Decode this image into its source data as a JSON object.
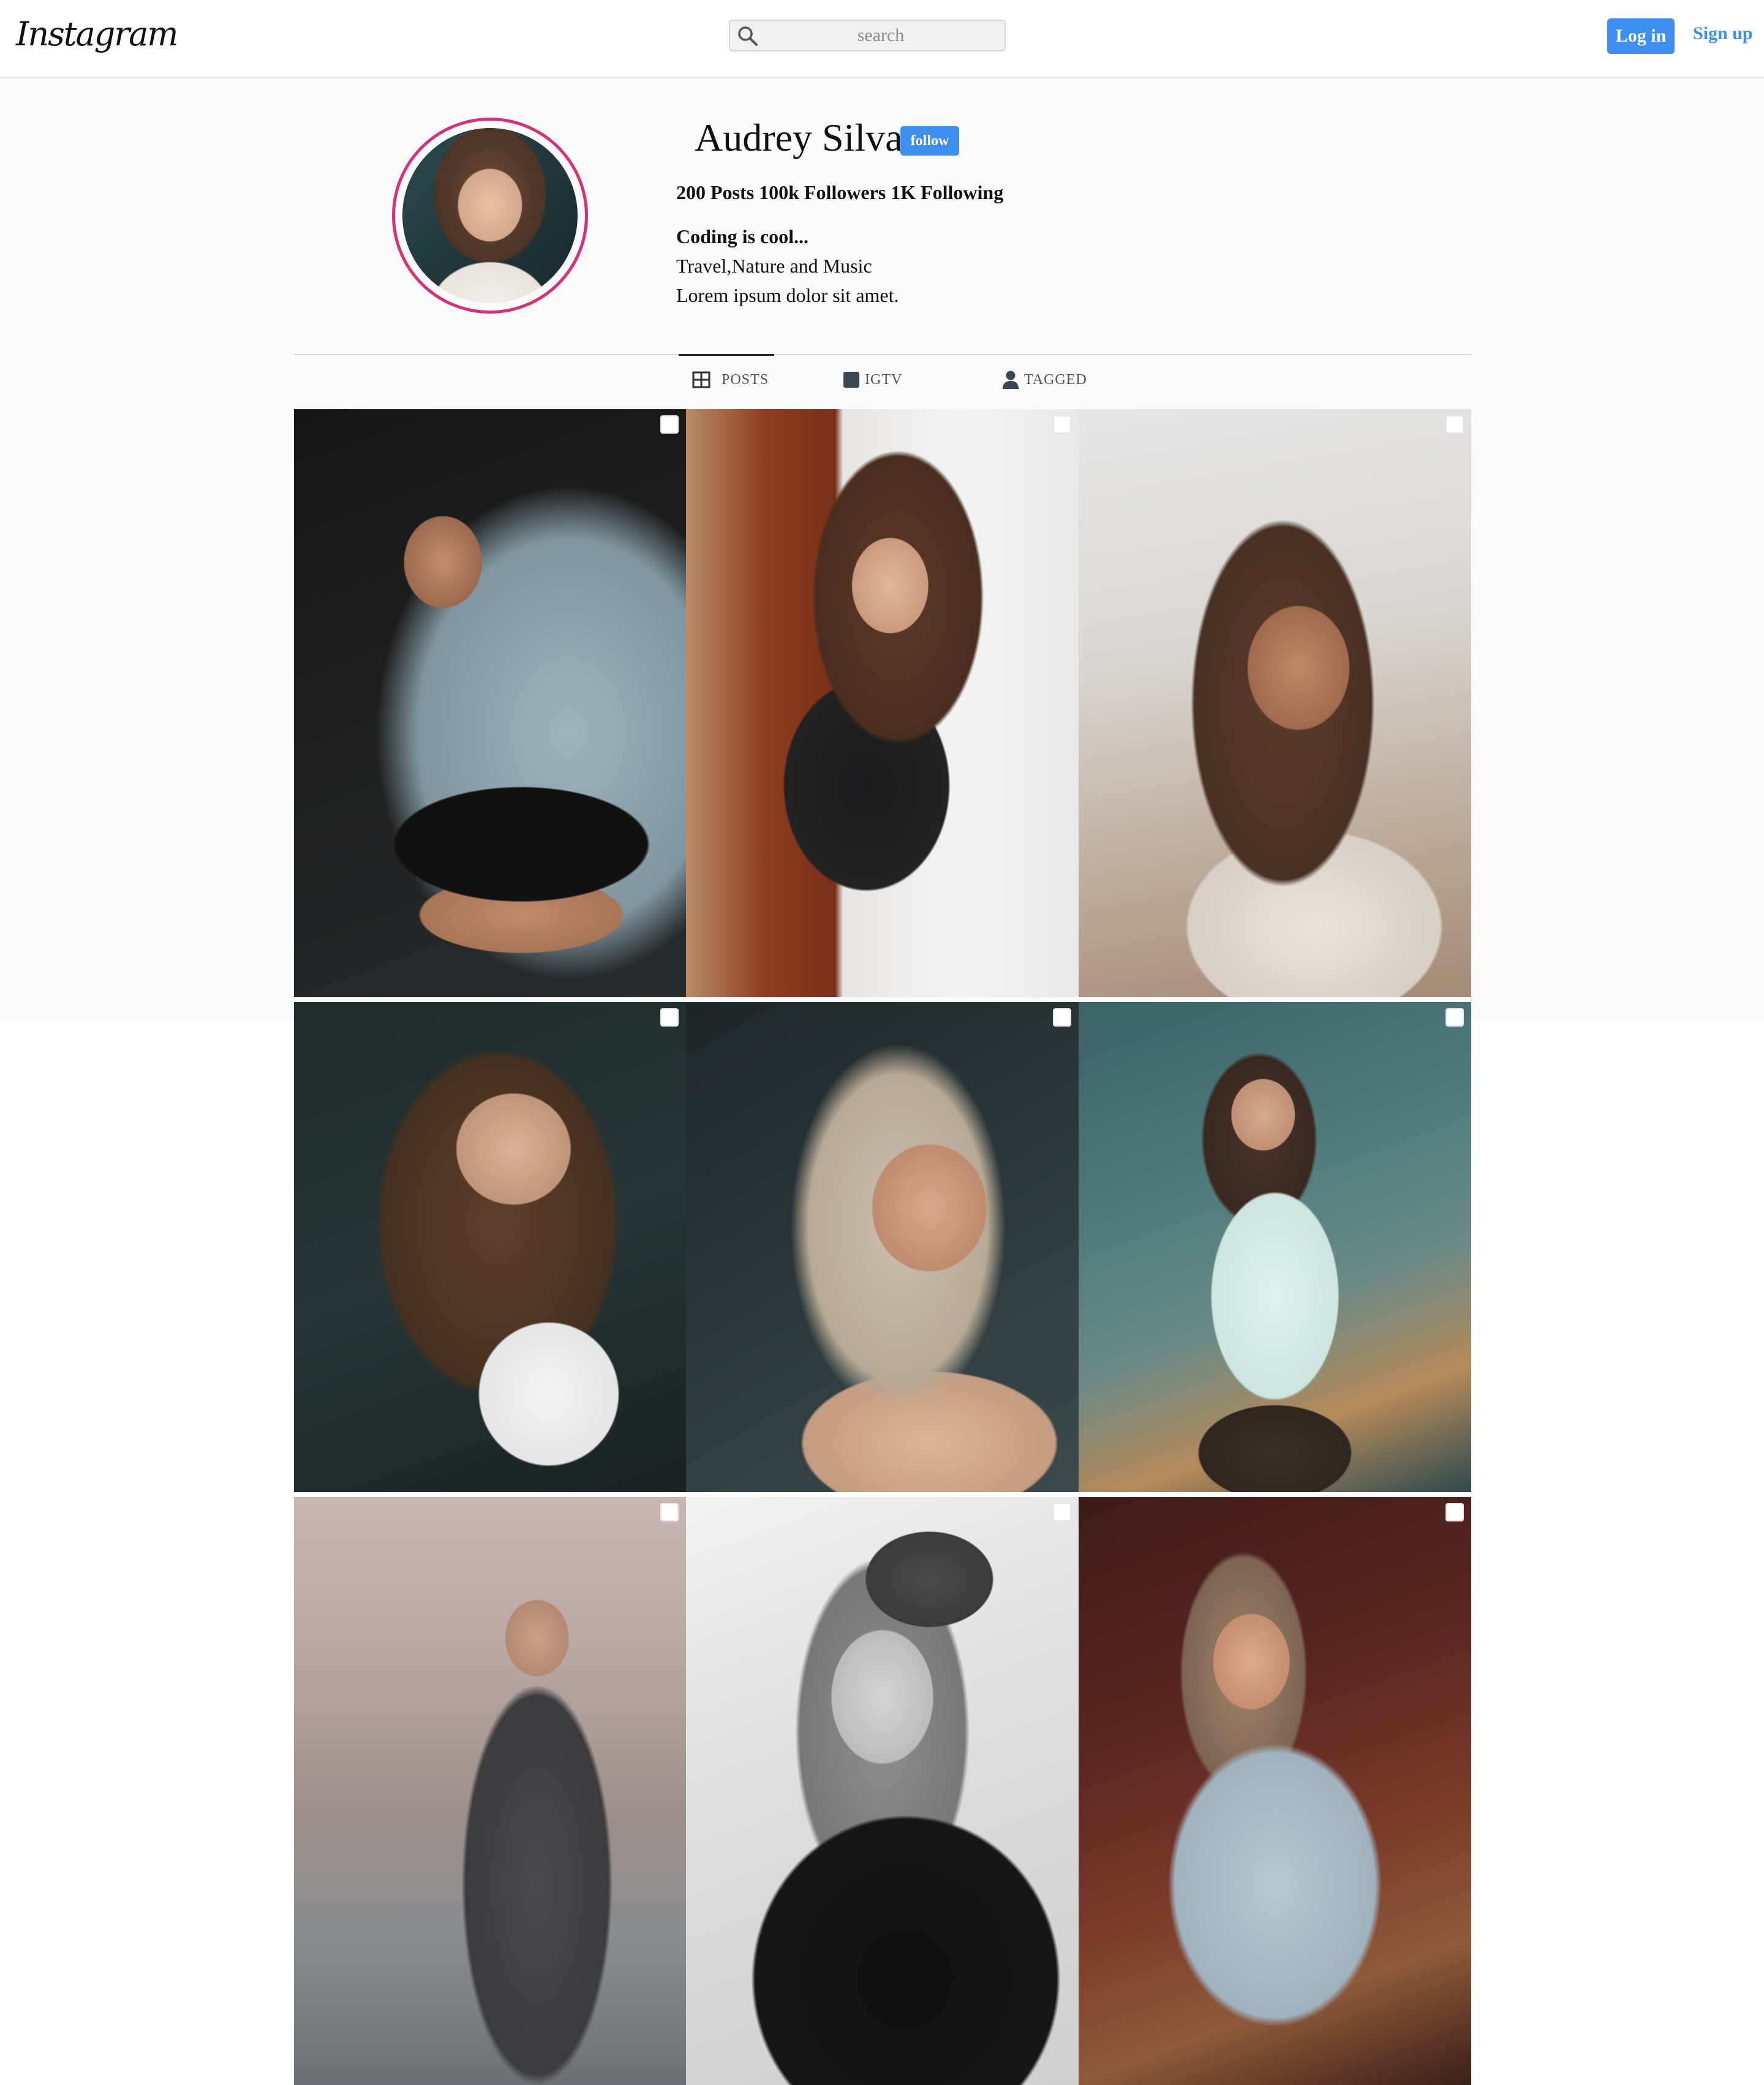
{
  "header": {
    "logo": "Instagram",
    "search_placeholder": "search",
    "login_label": "Log in",
    "signup_label": "Sign up"
  },
  "profile": {
    "name": "Audrey Silva",
    "follow_label": "follow",
    "stats": "200 Posts 100k Followers 1K Following",
    "bio_title": "Coding is cool...",
    "bio_lines": [
      "Travel,Nature and Music",
      "Lorem ipsum dolor sit amet."
    ]
  },
  "tabs": [
    {
      "label": "POSTS",
      "icon": "grid-icon",
      "active": true
    },
    {
      "label": "IGTV",
      "icon": "tv-icon",
      "active": false
    },
    {
      "label": "TAGGED",
      "icon": "user-icon",
      "active": false
    }
  ],
  "posts": [
    {
      "id": "post-1"
    },
    {
      "id": "post-2"
    },
    {
      "id": "post-3"
    },
    {
      "id": "post-4"
    },
    {
      "id": "post-5"
    },
    {
      "id": "post-6"
    },
    {
      "id": "post-7"
    },
    {
      "id": "post-8"
    },
    {
      "id": "post-9"
    }
  ],
  "colors": {
    "accent": "#3d8ff0",
    "avatar_ring": "#d6307a",
    "profile_background": "#fafafa"
  }
}
